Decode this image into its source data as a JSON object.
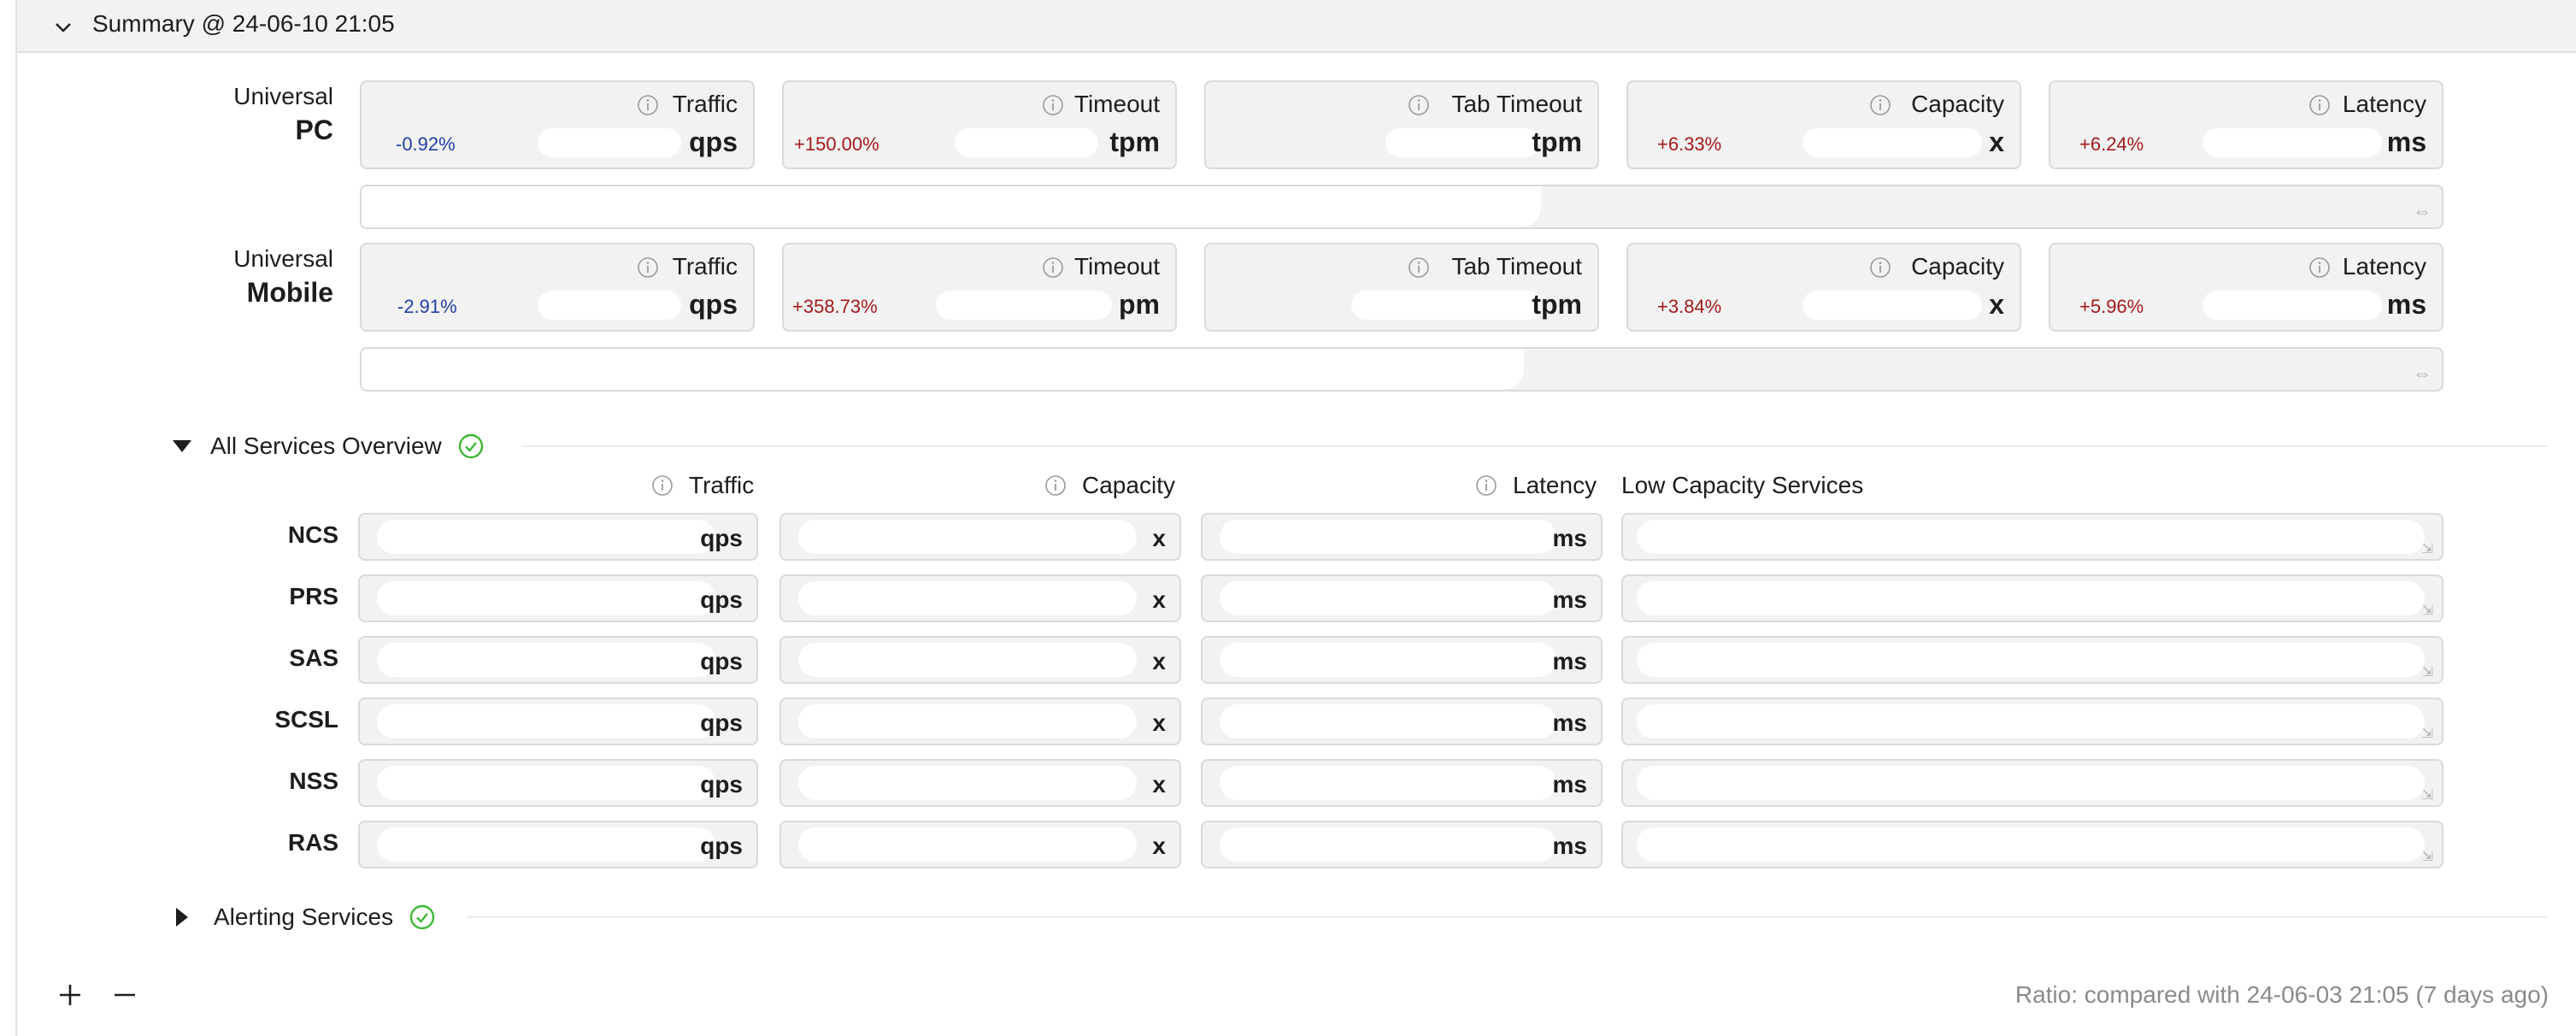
{
  "header": {
    "title": "Summary @ 24-06-10 21:05"
  },
  "groups": [
    {
      "sub": "Universal",
      "name": "PC",
      "cards": [
        {
          "title": "Traffic",
          "ratio": "-0.92%",
          "unit": "qps"
        },
        {
          "title": "Timeout",
          "ratio": "+150.00%",
          "unit": "tpm"
        },
        {
          "title": "Tab Timeout",
          "ratio": "",
          "unit": "tpm"
        },
        {
          "title": "Capacity",
          "ratio": "+6.33%",
          "unit": "x"
        },
        {
          "title": "Latency",
          "ratio": "+6.24%",
          "unit": "ms"
        }
      ]
    },
    {
      "sub": "Universal",
      "name": "Mobile",
      "cards": [
        {
          "title": "Traffic",
          "ratio": "-2.91%",
          "unit": "qps"
        },
        {
          "title": "Timeout",
          "ratio": "+358.73%",
          "unit": "pm"
        },
        {
          "title": "Tab Timeout",
          "ratio": "",
          "unit": "tpm"
        },
        {
          "title": "Capacity",
          "ratio": "+3.84%",
          "unit": "x"
        },
        {
          "title": "Latency",
          "ratio": "+5.96%",
          "unit": "ms"
        }
      ]
    }
  ],
  "overview": {
    "title": "All Services Overview",
    "columns": {
      "traffic": "Traffic",
      "capacity": "Capacity",
      "latency": "Latency",
      "low": "Low Capacity Services"
    },
    "units": {
      "traffic": "qps",
      "capacity": "x",
      "latency": "ms"
    },
    "rows": [
      {
        "name": "NCS"
      },
      {
        "name": "PRS"
      },
      {
        "name": "SAS"
      },
      {
        "name": "SCSL"
      },
      {
        "name": "NSS"
      },
      {
        "name": "RAS"
      }
    ]
  },
  "alerting": {
    "title": "Alerting Services"
  },
  "footer": {
    "add_label": "+",
    "remove_label": "−",
    "note": "Ratio: compared with 24-06-03 21:05 (7 days ago)"
  },
  "icons": {
    "header_chevron": "chevron-down-icon",
    "info": "info-icon",
    "status_ok": "check-circle-icon",
    "resize": "resize-icon"
  },
  "colors": {
    "negative": "#1f3fa8",
    "positive": "#a31a1a",
    "ok": "#3db832"
  }
}
